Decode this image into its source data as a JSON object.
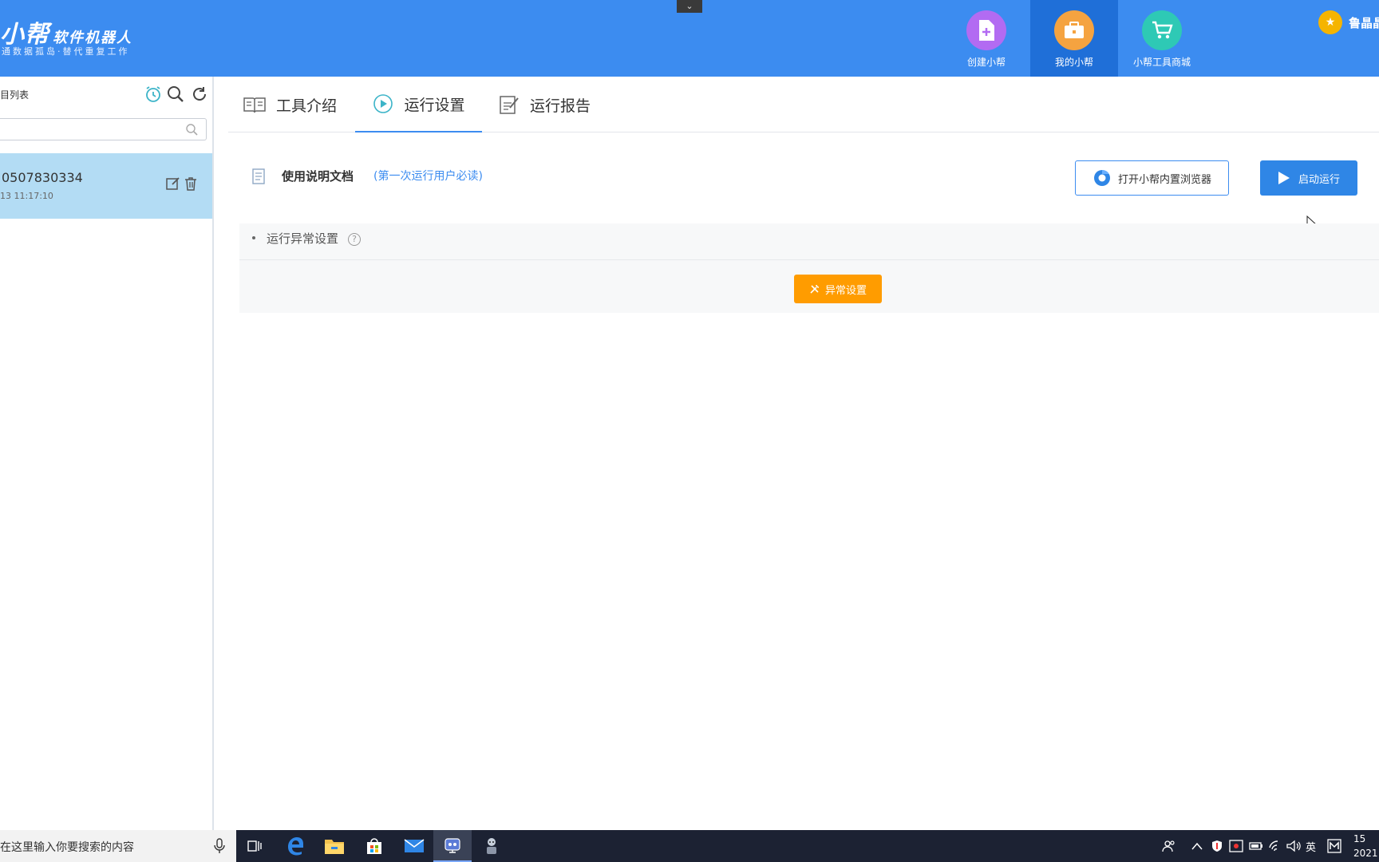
{
  "header": {
    "logo_title_big": "小帮",
    "logo_title_small": "软件机器人",
    "logo_subtitle": "通数据孤岛·替代重复工作",
    "nav": [
      {
        "label": "创建小帮",
        "icon": "create-doc-icon",
        "color": "#b26bf2"
      },
      {
        "label": "我的小帮",
        "icon": "briefcase-icon",
        "color": "#f5a340"
      },
      {
        "label": "小帮工具商城",
        "icon": "cart-icon",
        "color": "#2ec9b5"
      }
    ],
    "user_name": "鲁晶晶"
  },
  "sidebar": {
    "title": "目列表",
    "search_placeholder": "",
    "items": [
      {
        "name": "0507830334",
        "time": "13 11:17:10"
      }
    ]
  },
  "tabs": [
    {
      "label": "工具介绍",
      "icon": "book-icon"
    },
    {
      "label": "运行设置",
      "icon": "play-circle-icon"
    },
    {
      "label": "运行报告",
      "icon": "report-icon"
    }
  ],
  "run_settings": {
    "doc_title": "使用说明文档",
    "doc_hint": "(第一次运行用户必读)",
    "browser_button": "打开小帮内置浏览器",
    "run_button": "启动运行",
    "exception_title": "运行异常设置",
    "exception_button": "异常设置"
  },
  "taskbar": {
    "search_text": "在这里输入你要搜索的内容",
    "ime_label": "英",
    "clock_time": "15",
    "clock_date": "2021"
  },
  "colors": {
    "header_bg": "#3c8cf0",
    "nav_active_bg": "#1f6fd8",
    "sidebar_selected": "#b3dcf4",
    "primary": "#2f86e6",
    "warning": "#ff9c00",
    "taskbar": "#1c2233"
  }
}
